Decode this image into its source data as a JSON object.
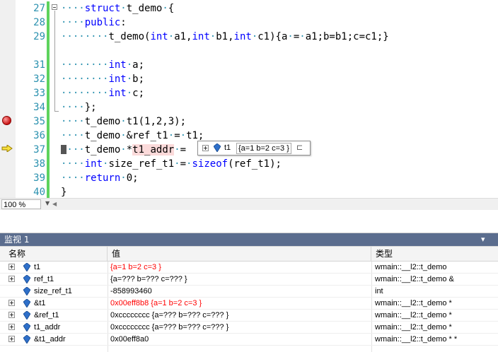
{
  "editor": {
    "code_lines": [
      {
        "num": "27",
        "parts": [
          [
            "ws",
            "····"
          ],
          [
            "kw",
            "struct"
          ],
          [
            "ws",
            "·"
          ],
          [
            "",
            "t_demo"
          ],
          [
            "ws",
            "·"
          ],
          [
            "",
            "{"
          ]
        ]
      },
      {
        "num": "28",
        "parts": [
          [
            "ws",
            "····"
          ],
          [
            "kw",
            "public"
          ],
          [
            "",
            ":"
          ]
        ]
      },
      {
        "num": "29",
        "parts": [
          [
            "ws",
            "········"
          ],
          [
            "",
            "t_demo("
          ],
          [
            "kw",
            "int"
          ],
          [
            "ws",
            "·"
          ],
          [
            "",
            "a1,"
          ],
          [
            "kw",
            "int"
          ],
          [
            "ws",
            "·"
          ],
          [
            "",
            "b1,"
          ],
          [
            "kw",
            "int"
          ],
          [
            "ws",
            "·"
          ],
          [
            "",
            "c1){a"
          ],
          [
            "ws",
            "·"
          ],
          [
            "",
            "="
          ],
          [
            "ws",
            "·"
          ],
          [
            "",
            "a1;b=b1;c=c1;}"
          ]
        ]
      },
      {
        "num": "",
        "parts": []
      },
      {
        "num": "31",
        "parts": [
          [
            "ws",
            "········"
          ],
          [
            "kw",
            "int"
          ],
          [
            "ws",
            "·"
          ],
          [
            "",
            "a;"
          ]
        ]
      },
      {
        "num": "32",
        "parts": [
          [
            "ws",
            "········"
          ],
          [
            "kw",
            "int"
          ],
          [
            "ws",
            "·"
          ],
          [
            "",
            "b;"
          ]
        ]
      },
      {
        "num": "33",
        "parts": [
          [
            "ws",
            "········"
          ],
          [
            "kw",
            "int"
          ],
          [
            "ws",
            "·"
          ],
          [
            "",
            "c;"
          ]
        ]
      },
      {
        "num": "34",
        "parts": [
          [
            "ws",
            "····"
          ],
          [
            "",
            "};"
          ]
        ]
      },
      {
        "num": "35",
        "parts": [
          [
            "ws",
            "····"
          ],
          [
            "",
            "t_demo"
          ],
          [
            "ws",
            "·"
          ],
          [
            "",
            "t1(1,2,3);"
          ]
        ]
      },
      {
        "num": "36",
        "parts": [
          [
            "ws",
            "····"
          ],
          [
            "",
            "t_demo"
          ],
          [
            "ws",
            "·"
          ],
          [
            "",
            "&ref_t1"
          ],
          [
            "ws",
            "·"
          ],
          [
            "",
            "="
          ],
          [
            "ws",
            "·"
          ],
          [
            "",
            "t1;"
          ]
        ]
      },
      {
        "num": "37",
        "parts": [
          [
            "ws",
            "····"
          ],
          [
            "",
            "t_demo"
          ],
          [
            "ws",
            "·"
          ],
          [
            "",
            "*"
          ],
          [
            "hl",
            "t1_addr"
          ],
          [
            "ws",
            "·"
          ],
          [
            "",
            "="
          ]
        ]
      },
      {
        "num": "38",
        "parts": [
          [
            "ws",
            "····"
          ],
          [
            "kw",
            "int"
          ],
          [
            "ws",
            "·"
          ],
          [
            "",
            "size_ref_t1"
          ],
          [
            "ws",
            "·"
          ],
          [
            "",
            "="
          ],
          [
            "ws",
            "·"
          ],
          [
            "kw",
            "sizeof"
          ],
          [
            "",
            "(ref_t1);"
          ]
        ]
      },
      {
        "num": "39",
        "parts": [
          [
            "ws",
            "····"
          ],
          [
            "kw",
            "return"
          ],
          [
            "ws",
            "·"
          ],
          [
            "",
            "0;"
          ]
        ]
      },
      {
        "num": "40",
        "parts": [
          [
            "",
            "}"
          ]
        ]
      }
    ]
  },
  "datatip": {
    "name": "t1",
    "value": "{a=1 b=2 c=3 }",
    "pin": "⊏"
  },
  "zoom": {
    "value": "100 %"
  },
  "watch": {
    "title": "监视 1",
    "pin": "▾",
    "columns": {
      "name": "名称",
      "value": "值",
      "type": "类型"
    },
    "rows": [
      {
        "expand": true,
        "name": "t1",
        "value": "{a=1 b=2 c=3 }",
        "type": "wmain::__l2::t_demo",
        "changed": true
      },
      {
        "expand": true,
        "name": "ref_t1",
        "value": "{a=??? b=??? c=??? }",
        "type": "wmain::__l2::t_demo &",
        "changed": false
      },
      {
        "expand": false,
        "name": "size_ref_t1",
        "value": "-858993460",
        "type": "int",
        "changed": false
      },
      {
        "expand": true,
        "name": "&t1",
        "value": "0x00eff8b8 {a=1 b=2 c=3 }",
        "type": "wmain::__l2::t_demo *",
        "changed": true
      },
      {
        "expand": true,
        "name": "&ref_t1",
        "value": "0xcccccccc {a=??? b=??? c=??? }",
        "type": "wmain::__l2::t_demo *",
        "changed": false
      },
      {
        "expand": true,
        "name": "t1_addr",
        "value": "0xcccccccc {a=??? b=??? c=??? }",
        "type": "wmain::__l2::t_demo *",
        "changed": false
      },
      {
        "expand": true,
        "name": "&t1_addr",
        "value": "0x00eff8a0",
        "type": "wmain::__l2::t_demo * *",
        "changed": false
      }
    ]
  },
  "colors": {
    "line_number": "#2b91af",
    "keyword": "#0000ff",
    "changed_value": "#ff0000",
    "panel_header": "#5b6d8e",
    "change_bar": "#5dd35d"
  },
  "icons": {
    "breakpoint": "breakpoint-icon",
    "current_statement": "current-statement-arrow-icon",
    "variable": "variable-icon",
    "pin": "pin-icon"
  }
}
